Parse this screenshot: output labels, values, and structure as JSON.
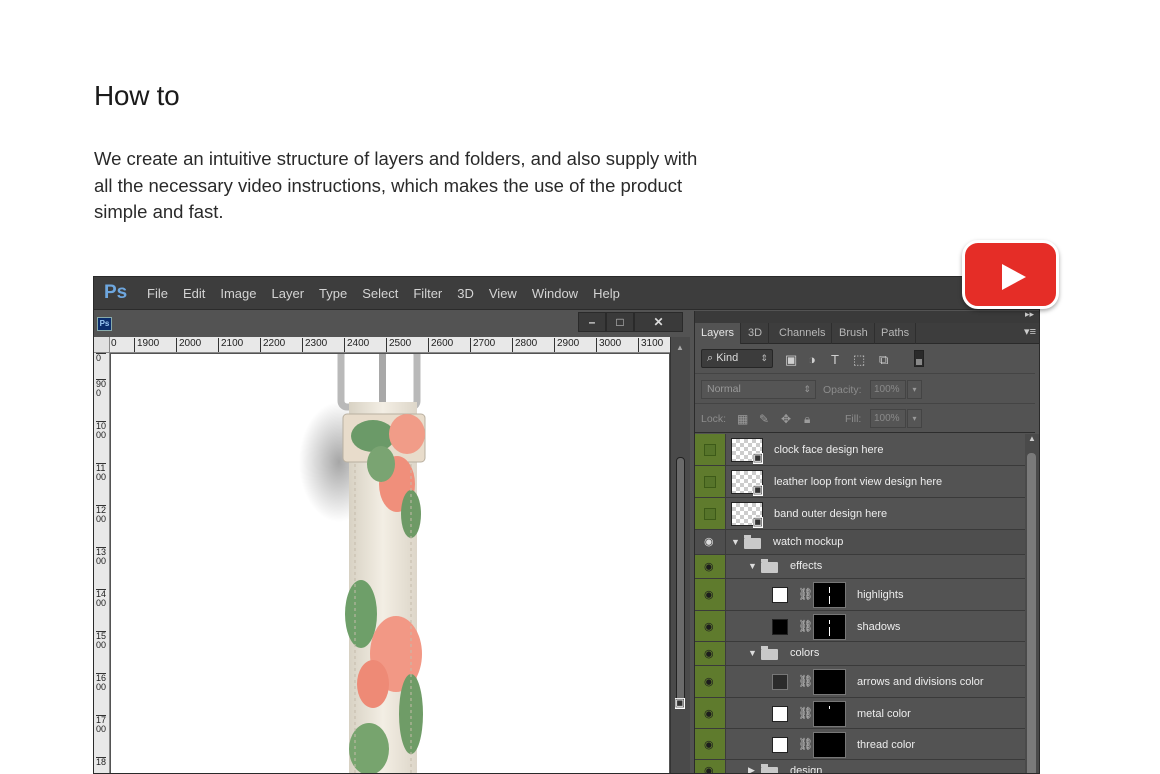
{
  "page": {
    "heading": "How to",
    "description": "We create an intuitive structure of layers and folders, and also supply with all the necessary video instructions, which makes the use of the product simple and fast."
  },
  "youtube": {
    "icon": "youtube-play-icon",
    "color": "#e52d27"
  },
  "app": {
    "logo": "Ps",
    "menu": [
      "File",
      "Edit",
      "Image",
      "Layer",
      "Type",
      "Select",
      "Filter",
      "3D",
      "View",
      "Window",
      "Help"
    ],
    "doc_icon": "Ps",
    "window_controls": [
      "–",
      "□",
      "✕"
    ],
    "ruler_top": [
      "0",
      "1900",
      "2000",
      "2100",
      "2200",
      "2300",
      "2400",
      "2500",
      "2600",
      "2700",
      "2800",
      "2900",
      "3000",
      "3100"
    ],
    "ruler_left": [
      "0",
      "900",
      "1000",
      "1100",
      "1200",
      "1300",
      "1400",
      "1500",
      "1600",
      "1700",
      "18"
    ]
  },
  "panel": {
    "tabs": [
      "Layers",
      "3D",
      "Channels",
      "Brush",
      "Paths"
    ],
    "filter_kind": "Kind",
    "blend_mode": "Normal",
    "opacity_label": "Opacity:",
    "opacity_value": "100%",
    "lock_label": "Lock:",
    "fill_label": "Fill:",
    "fill_value": "100%",
    "accent_color": "#5f7b2d",
    "layers": [
      {
        "name": "clock face design here",
        "kind": "smart",
        "visible": false
      },
      {
        "name": "leather loop front view design here",
        "kind": "smart",
        "visible": false
      },
      {
        "name": "band outer design here",
        "kind": "smart",
        "visible": false
      },
      {
        "name": "watch mockup",
        "kind": "group-open",
        "visible": true
      },
      {
        "name": "effects",
        "kind": "group-open",
        "visible": true
      },
      {
        "name": "highlights",
        "kind": "fill-mask",
        "swatch": "#ffffff",
        "visible": true
      },
      {
        "name": "shadows",
        "kind": "fill-mask",
        "swatch": "#000000",
        "visible": true
      },
      {
        "name": "colors",
        "kind": "group-open",
        "visible": true
      },
      {
        "name": "arrows and divisions color",
        "kind": "fill-mask",
        "swatch": "#2b2b2b",
        "visible": true
      },
      {
        "name": "metal color",
        "kind": "fill-mask",
        "swatch": "#ffffff",
        "visible": true
      },
      {
        "name": "thread color",
        "kind": "fill-mask",
        "swatch": "#ffffff",
        "visible": true
      },
      {
        "name": "design",
        "kind": "group-closed",
        "visible": true
      }
    ]
  }
}
